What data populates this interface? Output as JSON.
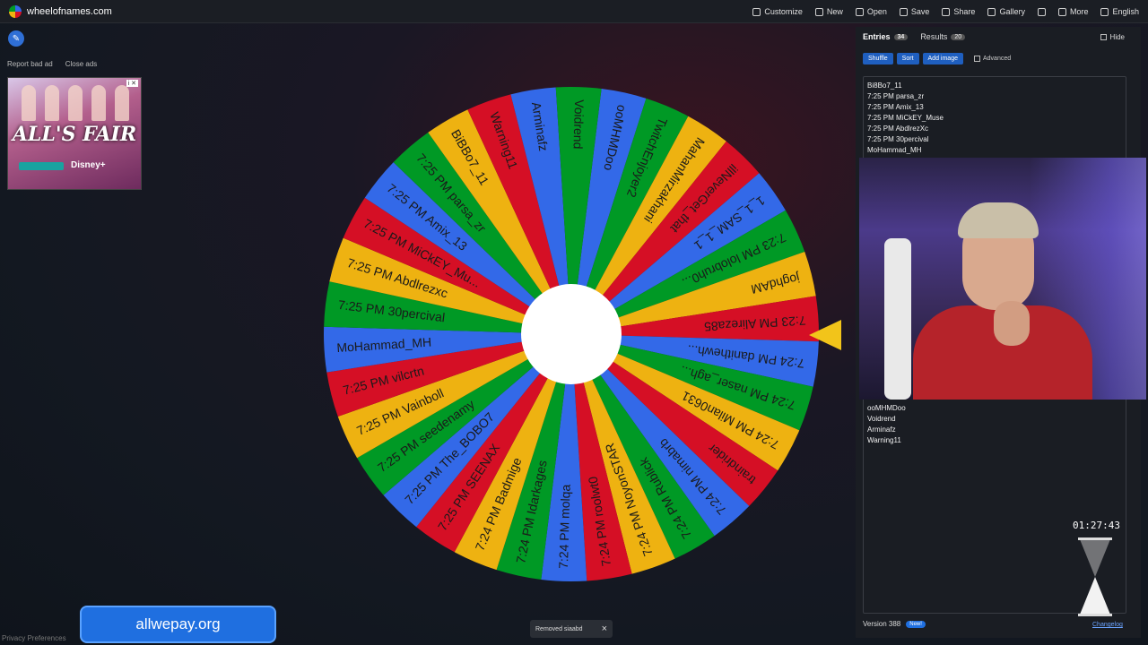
{
  "site": {
    "name": "wheelofnames.com"
  },
  "menu": [
    {
      "label": "Customize",
      "icon": "palette-icon"
    },
    {
      "label": "New",
      "icon": "file-icon"
    },
    {
      "label": "Open",
      "icon": "folder-icon"
    },
    {
      "label": "Save",
      "icon": "save-icon"
    },
    {
      "label": "Share",
      "icon": "share-icon"
    },
    {
      "label": "Gallery",
      "icon": "search-icon"
    },
    {
      "label": "",
      "icon": "fullscreen-icon"
    },
    {
      "label": "More",
      "icon": "chevron-down-icon"
    },
    {
      "label": "English",
      "icon": "globe-icon"
    }
  ],
  "ads": {
    "report_label": "Report bad ad",
    "close_label": "Close ads",
    "ad_title": "ALL'S FAIR",
    "ad_sub": "Disney+"
  },
  "wheel": {
    "colors": [
      "#3369e8",
      "#009925",
      "#eeb211",
      "#d50f25"
    ],
    "slices": [
      "ooMHMDoo",
      "TwitchEnjoyer2",
      "MahanMirzakhani",
      "illNeverGet_that",
      "1_1_SAM_1_1",
      "7:23 PM lolobruh0...",
      "joghdAM",
      "7:23 PM Alireza85",
      "7:24 PM danithewh...",
      "7:24 PM naser_agh...",
      "7:24 PM Milan0631",
      "traindrider",
      "7:24 PM nimabrb",
      "7:24 PM Rublick",
      "7:24 PM NoyonSTAR",
      "7:24 PM roolwt0",
      "7:24 PM molqa",
      "7:24 PM Idarkages",
      "7:24 PM Badmige",
      "7:25 PM SEENAX",
      "7:25 PM The_BOBO7",
      "7:25 PM seedenamy",
      "7:25 PM Vainboll",
      "7:25 PM vilcrtn",
      "MoHammad_MH",
      "7:25 PM 30percival",
      "7:25 PM Abdlrezxc",
      "7:25 PM MiCkEY_Mu...",
      "7:25 PM Amix_13",
      "7:25 PM parsa_zr",
      "BiBBo7_11",
      "Warning11",
      "Arminafz",
      "Voidrend"
    ]
  },
  "toast": {
    "text": "Removed siaabd",
    "close": "×"
  },
  "panel": {
    "tab_entries": "Entries",
    "entries_count": "34",
    "tab_results": "Results",
    "results_count": "20",
    "hide_label": "Hide",
    "shuffle": "Shuffle",
    "sort": "Sort",
    "add_image": "Add image",
    "advanced": "Advanced",
    "entries_top": [
      "Bi8Bo7_11",
      "7:25 PM parsa_zr",
      "7:25 PM Amix_13",
      "7:25 PM MiCkEY_Muse",
      "7:25 PM AbdlrezXc",
      "7:25 PM 30percival",
      "MoHammad_MH"
    ],
    "entries_bottom": [
      "ooMHMDoo",
      "Voidrend",
      "Arminafz",
      "Warning11"
    ]
  },
  "overlay": {
    "timer": "01:27:43",
    "banner": "allwepay.org"
  },
  "footer": {
    "privacy": "Privacy Preferences",
    "version": "Version 388",
    "new_badge": "New!",
    "changelog": "Changelog"
  }
}
